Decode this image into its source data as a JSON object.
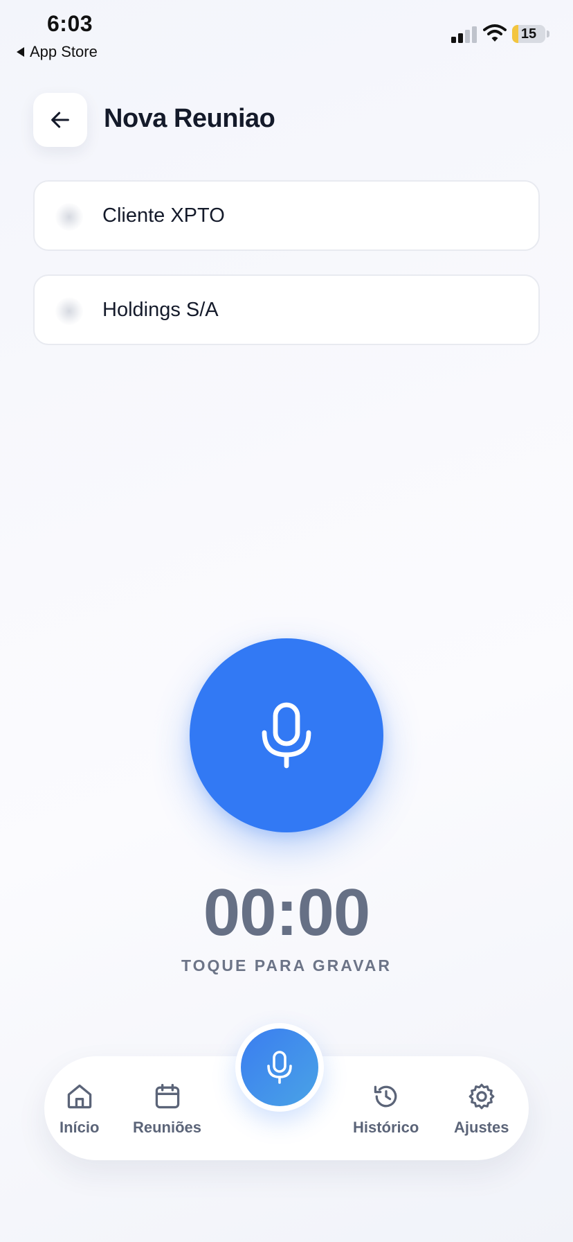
{
  "status_bar": {
    "time": "6:03",
    "back_app": "App Store",
    "battery": "15",
    "icons": [
      "signal-icon",
      "wifi-icon",
      "battery-icon"
    ]
  },
  "header": {
    "title": "Nova Reuniao",
    "back_icon": "arrow-left-icon"
  },
  "cards": [
    {
      "label": "Cliente XPTO"
    },
    {
      "label": "Holdings S/A"
    }
  ],
  "recorder": {
    "timer": "00:00",
    "hint": "TOQUE PARA GRAVAR",
    "icon": "microphone-icon"
  },
  "bottom_nav": {
    "items": [
      {
        "label": "Início",
        "icon": "home-icon"
      },
      {
        "label": "Reuniões",
        "icon": "calendar-icon"
      },
      {
        "label": "Histórico",
        "icon": "history-icon"
      },
      {
        "label": "Ajustes",
        "icon": "gear-icon"
      }
    ],
    "fab_icon": "microphone-icon"
  },
  "colors": {
    "accent": "#3279f4",
    "text_dark": "#141a2a",
    "text_muted": "#667085"
  }
}
